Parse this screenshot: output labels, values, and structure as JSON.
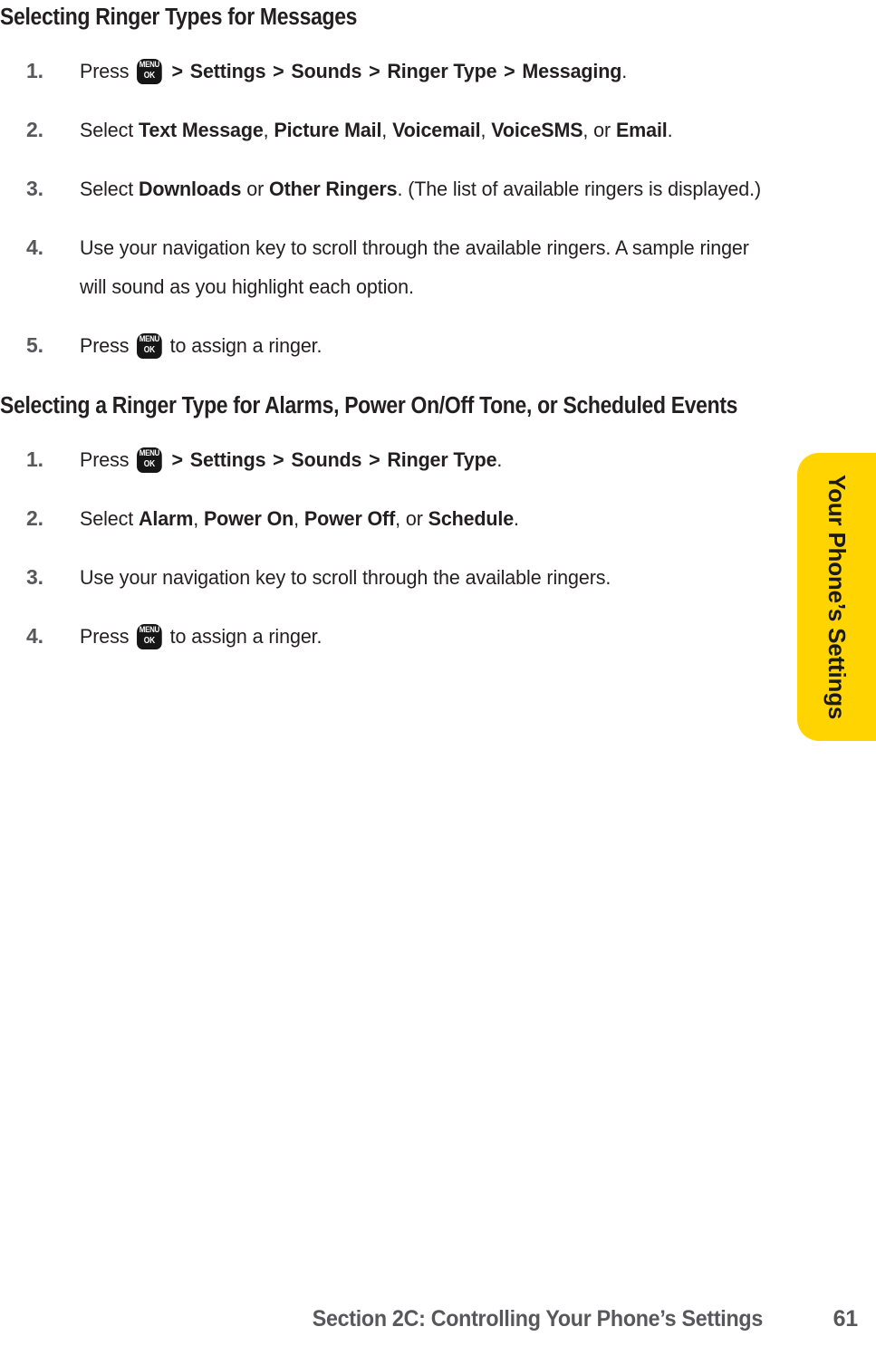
{
  "page": {
    "background_color": "#ffffff",
    "text_color": "#231f20",
    "accent_color": "#ffd400",
    "number_color": "#58585b"
  },
  "side_tab": {
    "label": "Your Phone’s Settings",
    "color": "#ffd400"
  },
  "footer": {
    "title": "Section 2C: Controlling Your Phone’s Settings",
    "page_number": "61"
  },
  "menu_key": {
    "top_label": "MENU",
    "bottom_label": "OK"
  },
  "sections": [
    {
      "heading": "Selecting Ringer Types for Messages",
      "steps": [
        {
          "number": "1.",
          "parts": [
            {
              "type": "text",
              "value": "Press "
            },
            {
              "type": "menu-key"
            },
            {
              "type": "chevron",
              "value": " > "
            },
            {
              "type": "bold",
              "value": "Settings"
            },
            {
              "type": "chevron",
              "value": " > "
            },
            {
              "type": "bold",
              "value": "Sounds"
            },
            {
              "type": "chevron",
              "value": " > "
            },
            {
              "type": "bold",
              "value": "Ringer Type"
            },
            {
              "type": "chevron",
              "value": " > "
            },
            {
              "type": "bold",
              "value": "Messaging"
            },
            {
              "type": "text",
              "value": "."
            }
          ]
        },
        {
          "number": "2.",
          "parts": [
            {
              "type": "text",
              "value": "Select "
            },
            {
              "type": "bold",
              "value": "Text Message"
            },
            {
              "type": "text",
              "value": ", "
            },
            {
              "type": "bold",
              "value": "Picture Mail"
            },
            {
              "type": "text",
              "value": ", "
            },
            {
              "type": "bold",
              "value": "Voicemail"
            },
            {
              "type": "text",
              "value": ", "
            },
            {
              "type": "bold",
              "value": "VoiceSMS"
            },
            {
              "type": "text",
              "value": ", or "
            },
            {
              "type": "bold",
              "value": "Email"
            },
            {
              "type": "text",
              "value": "."
            }
          ]
        },
        {
          "number": "3.",
          "parts": [
            {
              "type": "text",
              "value": "Select "
            },
            {
              "type": "bold",
              "value": "Downloads"
            },
            {
              "type": "text",
              "value": " or "
            },
            {
              "type": "bold",
              "value": "Other Ringers"
            },
            {
              "type": "text",
              "value": ". (The list of available ringers is displayed.)"
            }
          ]
        },
        {
          "number": "4.",
          "parts": [
            {
              "type": "text",
              "value": "Use your navigation key to scroll through the available ringers. A sample ringer will sound as you highlight each option."
            }
          ]
        },
        {
          "number": "5.",
          "parts": [
            {
              "type": "text",
              "value": "Press "
            },
            {
              "type": "menu-key"
            },
            {
              "type": "text",
              "value": " to assign a ringer."
            }
          ]
        }
      ]
    },
    {
      "heading": "Selecting a Ringer Type for Alarms, Power On/Off Tone, or Scheduled Events",
      "steps": [
        {
          "number": "1.",
          "parts": [
            {
              "type": "text",
              "value": "Press "
            },
            {
              "type": "menu-key"
            },
            {
              "type": "chevron",
              "value": " > "
            },
            {
              "type": "bold",
              "value": "Settings"
            },
            {
              "type": "chevron",
              "value": " > "
            },
            {
              "type": "bold",
              "value": "Sounds"
            },
            {
              "type": "chevron",
              "value": " > "
            },
            {
              "type": "bold",
              "value": "Ringer Type"
            },
            {
              "type": "text",
              "value": "."
            }
          ]
        },
        {
          "number": "2.",
          "parts": [
            {
              "type": "text",
              "value": "Select "
            },
            {
              "type": "bold",
              "value": "Alarm"
            },
            {
              "type": "text",
              "value": ", "
            },
            {
              "type": "bold",
              "value": "Power On"
            },
            {
              "type": "text",
              "value": ", "
            },
            {
              "type": "bold",
              "value": "Power Off"
            },
            {
              "type": "text",
              "value": ", or "
            },
            {
              "type": "bold",
              "value": "Schedule"
            },
            {
              "type": "text",
              "value": "."
            }
          ]
        },
        {
          "number": "3.",
          "parts": [
            {
              "type": "text",
              "value": "Use your navigation key to scroll through the available ringers."
            }
          ]
        },
        {
          "number": "4.",
          "parts": [
            {
              "type": "text",
              "value": "Press "
            },
            {
              "type": "menu-key"
            },
            {
              "type": "text",
              "value": " to assign a ringer."
            }
          ]
        }
      ]
    }
  ]
}
